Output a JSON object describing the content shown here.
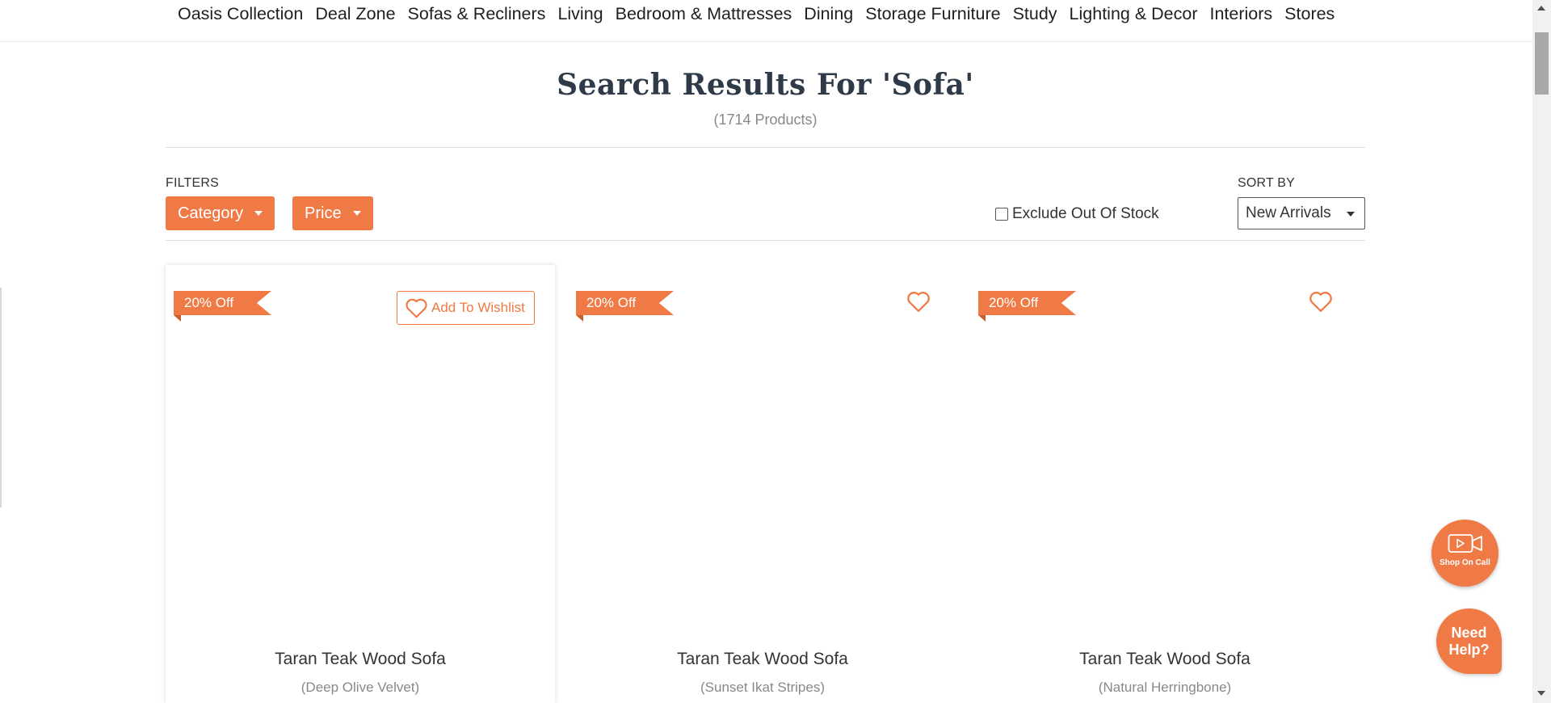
{
  "nav": {
    "items": [
      {
        "label": "Oasis Collection"
      },
      {
        "label": "Deal Zone"
      },
      {
        "label": "Sofas & Recliners"
      },
      {
        "label": "Living"
      },
      {
        "label": "Bedroom & Mattresses"
      },
      {
        "label": "Dining"
      },
      {
        "label": "Storage Furniture"
      },
      {
        "label": "Study"
      },
      {
        "label": "Lighting & Decor"
      },
      {
        "label": "Interiors"
      },
      {
        "label": "Stores"
      }
    ]
  },
  "results": {
    "title_prefix": "Search Results For ",
    "query": "'Sofa'",
    "count_text": "(1714 Products)"
  },
  "filters": {
    "label": "FILTERS",
    "category_label": "Category",
    "price_label": "Price",
    "exclude_out_of_stock_label": "Exclude Out Of Stock",
    "exclude_out_of_stock_checked": false
  },
  "sort": {
    "label": "SORT BY",
    "selected": "New Arrivals"
  },
  "products": [
    {
      "discount": "20% Off",
      "wishlist_label": "Add To Wishlist",
      "name": "Taran Teak Wood Sofa",
      "variant": "(Deep Olive Velvet)"
    },
    {
      "discount": "20% Off",
      "name": "Taran Teak Wood Sofa",
      "variant": "(Sunset Ikat Stripes)"
    },
    {
      "discount": "20% Off",
      "name": "Taran Teak Wood Sofa",
      "variant": "(Natural Herringbone)"
    }
  ],
  "widgets": {
    "shop_on_call_label": "Shop On Call",
    "need_help_label": "Need Help?"
  },
  "colors": {
    "accent": "#f07a46",
    "title": "#2e3a48",
    "muted": "#888888"
  },
  "icons": [
    "heart-icon",
    "video-camera-icon",
    "caret-down-icon"
  ]
}
